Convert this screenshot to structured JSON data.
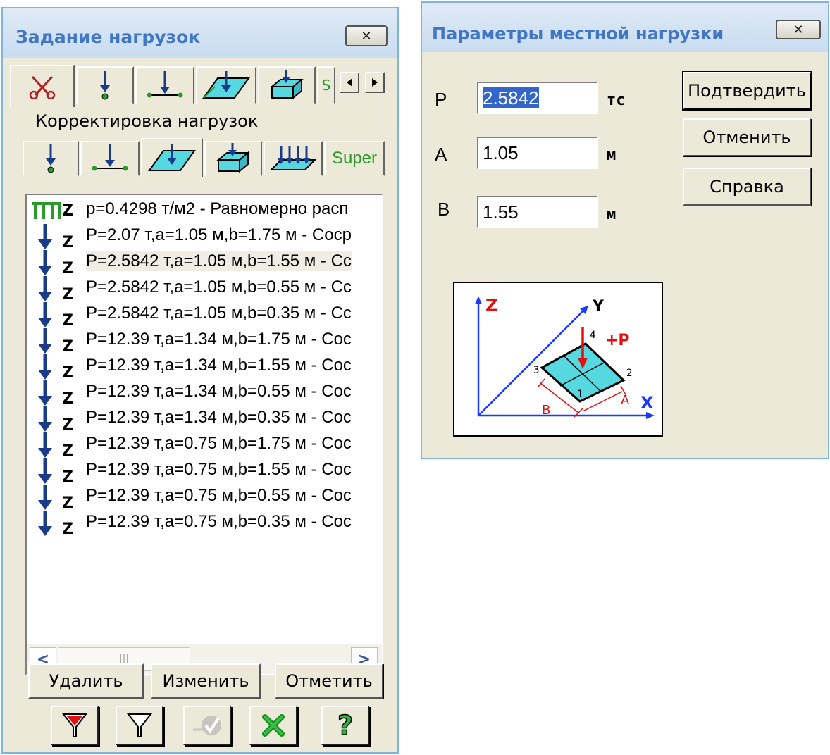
{
  "load_window": {
    "title": "Задание нагрузок",
    "close_label": "✕",
    "tabs": [
      {
        "name": "cut-icon",
        "active": true
      },
      {
        "name": "node-force-icon"
      },
      {
        "name": "beam-force-icon"
      },
      {
        "name": "plate-load-icon"
      },
      {
        "name": "solid-load-icon"
      },
      {
        "name": "tab-more",
        "label": "S"
      }
    ],
    "group_label": "Корректировка нагрузок",
    "subtabs": [
      {
        "name": "node-force-icon"
      },
      {
        "name": "beam-force-icon"
      },
      {
        "name": "plate-load-icon",
        "active": true
      },
      {
        "name": "solid-load-icon"
      },
      {
        "name": "multi-load-icon"
      },
      {
        "name": "super-tab",
        "label": "Super"
      }
    ],
    "loads": [
      {
        "icon": "distributed-load-icon",
        "axis": "Z",
        "text": "p=0.4298 т/м2 - Равномерно расп"
      },
      {
        "icon": "point-load-icon",
        "axis": "Z",
        "text": "P=2.07 т,a=1.05 м,b=1.75 м - Соср"
      },
      {
        "icon": "point-load-icon",
        "axis": "Z",
        "text": "P=2.5842 т,a=1.05 м,b=1.55 м - Сс",
        "selected": true
      },
      {
        "icon": "point-load-icon",
        "axis": "Z",
        "text": "P=2.5842 т,a=1.05 м,b=0.55 м - Сс"
      },
      {
        "icon": "point-load-icon",
        "axis": "Z",
        "text": "P=2.5842 т,a=1.05 м,b=0.35 м - Сс"
      },
      {
        "icon": "point-load-icon",
        "axis": "Z",
        "text": "P=12.39 т,a=1.34 м,b=1.75 м - Сос"
      },
      {
        "icon": "point-load-icon",
        "axis": "Z",
        "text": "P=12.39 т,a=1.34 м,b=1.55 м - Сос"
      },
      {
        "icon": "point-load-icon",
        "axis": "Z",
        "text": "P=12.39 т,a=1.34 м,b=0.55 м - Сос"
      },
      {
        "icon": "point-load-icon",
        "axis": "Z",
        "text": "P=12.39 т,a=1.34 м,b=0.35 м - Сос"
      },
      {
        "icon": "point-load-icon",
        "axis": "Z",
        "text": "P=12.39 т,a=0.75 м,b=1.75 м - Сос"
      },
      {
        "icon": "point-load-icon",
        "axis": "Z",
        "text": "P=12.39 т,a=0.75 м,b=1.55 м - Сос"
      },
      {
        "icon": "point-load-icon",
        "axis": "Z",
        "text": "P=12.39 т,a=0.75 м,b=0.55 м - Сос"
      },
      {
        "icon": "point-load-icon",
        "axis": "Z",
        "text": "P=12.39 т,a=0.75 м,b=0.35 м - Сос"
      }
    ],
    "scroll_left": "<",
    "scroll_right": ">",
    "scroll_grip": "|||",
    "delete_label": "Удалить",
    "edit_label": "Изменить",
    "mark_label": "Отметить",
    "tool_icons": [
      "filter-marked-icon",
      "filter-icon",
      "apply-disabled-icon",
      "close-x-icon",
      "help-icon"
    ],
    "help_glyph": "?"
  },
  "param_window": {
    "title": "Параметры местной нагрузки",
    "close_label": "✕",
    "p_label": "P",
    "p_value": "2.5842",
    "p_unit": "тс",
    "a_label": "A",
    "a_value": "1.05",
    "a_unit": "м",
    "b_label": "B",
    "b_value": "1.55",
    "b_unit": "м",
    "confirm_label": "Подтвердить",
    "cancel_label": "Отменить",
    "help_label": "Справка",
    "diagram": {
      "axis_z": "Z",
      "axis_y": "Y",
      "axis_x": "X",
      "force": "+P",
      "dim_a": "A",
      "dim_b": "B",
      "n1": "1",
      "n2": "2",
      "n3": "3",
      "n4": "4"
    }
  },
  "colors": {
    "accent": "#3f77c4",
    "load_arrow": "#1a3a8a",
    "node_green": "#2a9a2a",
    "plate_cyan": "#56d8e0",
    "force_red": "#e01010"
  }
}
